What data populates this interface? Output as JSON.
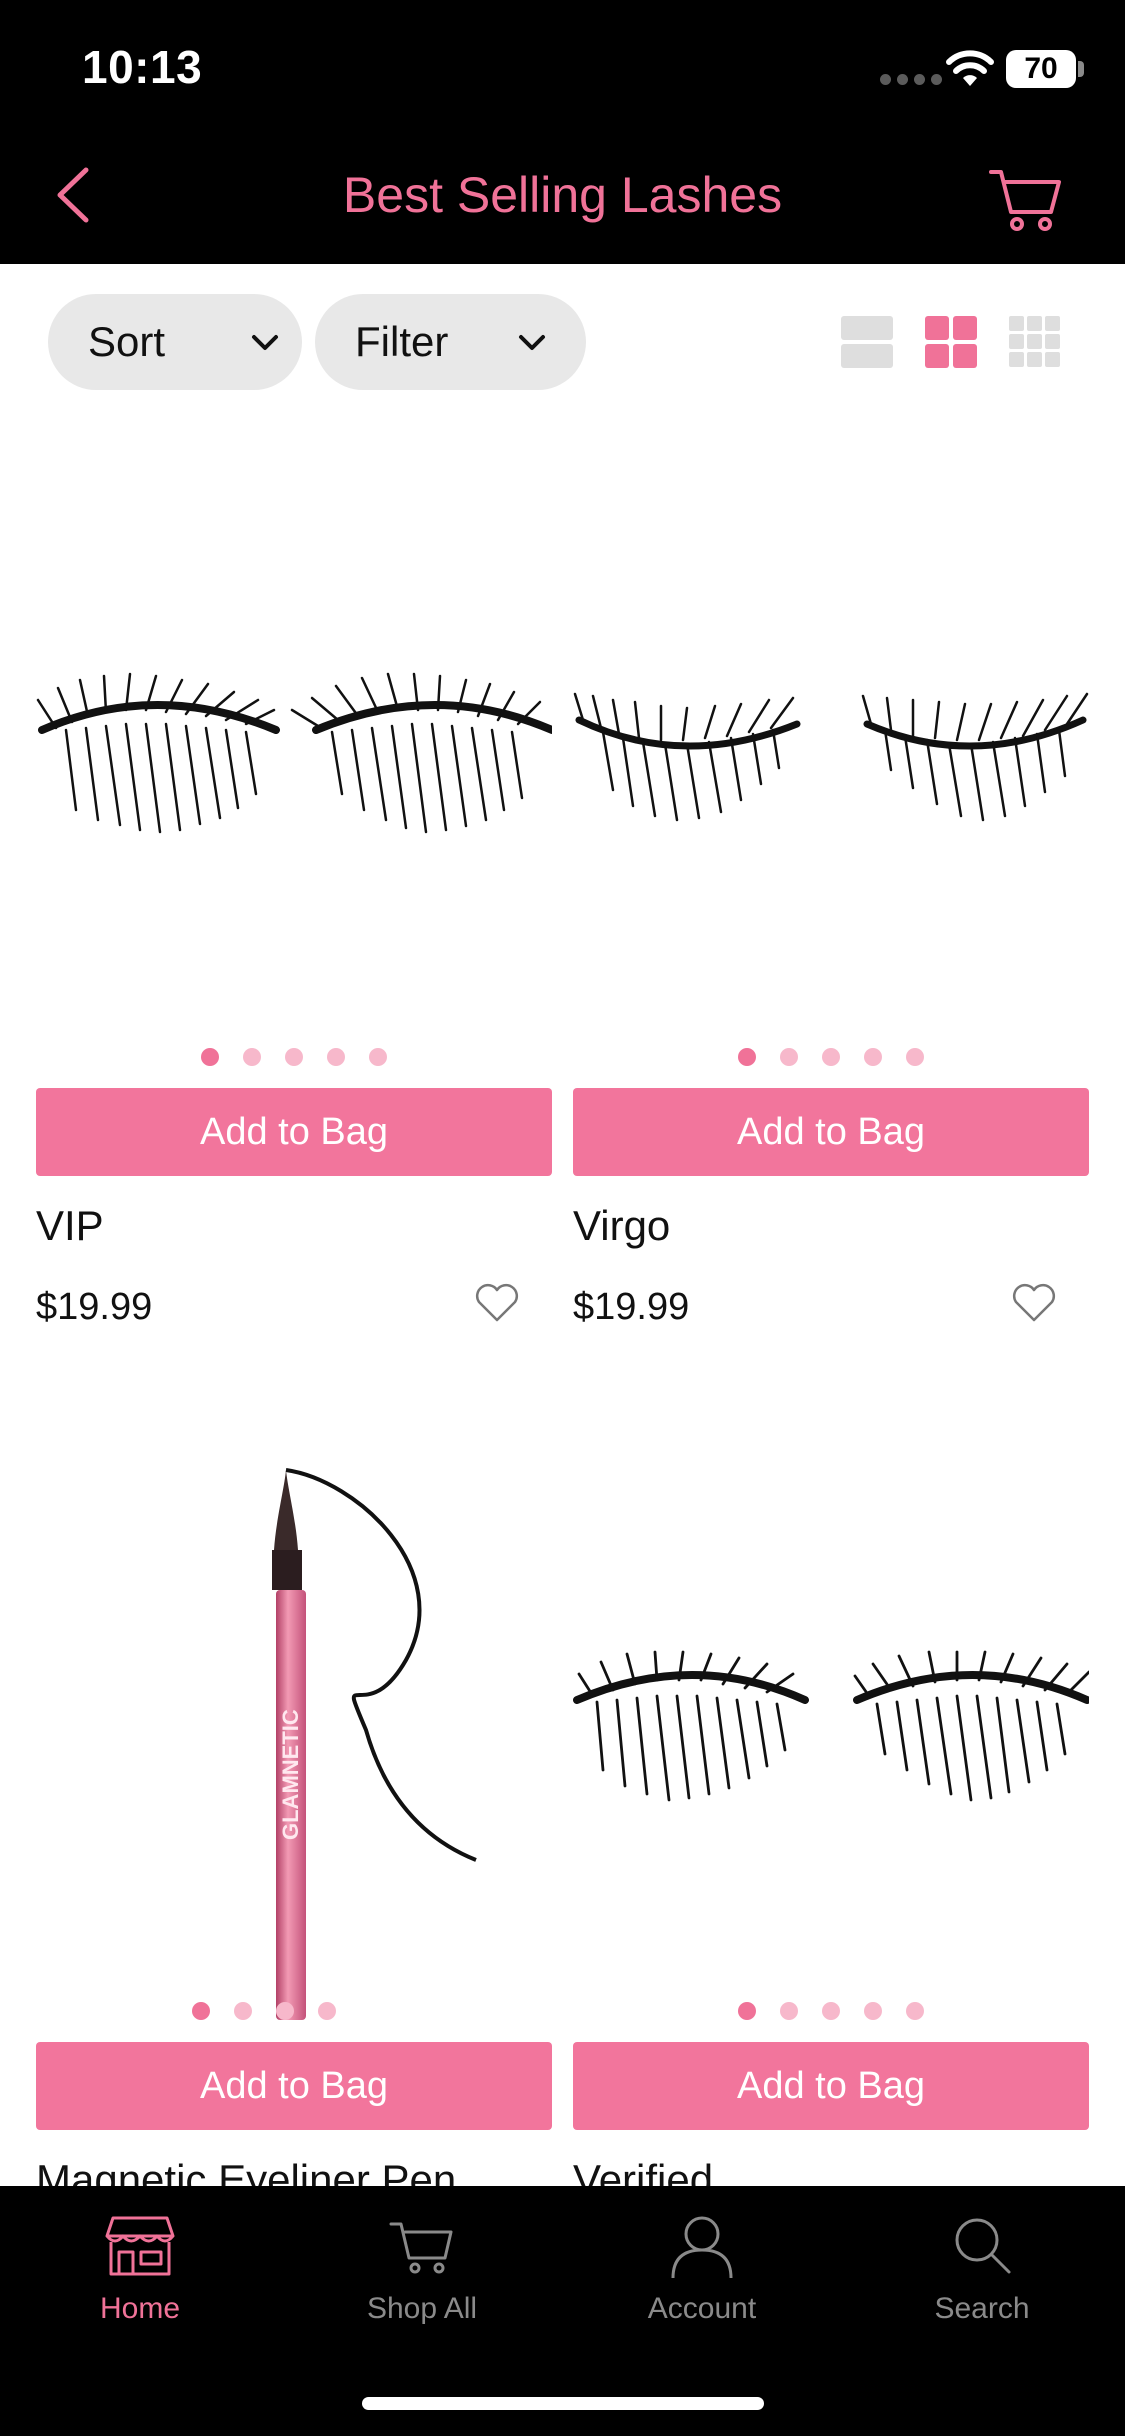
{
  "status_bar": {
    "time": "10:13",
    "battery": "70"
  },
  "header": {
    "title": "Best Selling Lashes",
    "back_icon": "chevron-left-icon",
    "cart_icon": "cart-icon"
  },
  "toolbar": {
    "sort_label": "Sort",
    "filter_label": "Filter",
    "view_modes": [
      "list-view-icon",
      "grid-2-view-icon",
      "grid-3-view-icon"
    ],
    "active_view": "grid-2-view-icon"
  },
  "products": [
    {
      "name": "VIP",
      "price": "$19.99",
      "button": "Add to Bag",
      "image_count": 5,
      "active_image": 1
    },
    {
      "name": "Virgo",
      "price": "$19.99",
      "button": "Add to Bag",
      "image_count": 5,
      "active_image": 1
    },
    {
      "name": "Magnetic Eyeliner Pen",
      "price": "",
      "button": "Add to Bag",
      "image_count": 4,
      "active_image": 1
    },
    {
      "name": "Verified",
      "price": "",
      "button": "Add to Bag",
      "image_count": 5,
      "active_image": 1
    }
  ],
  "tab_bar": {
    "items": [
      {
        "label": "Home",
        "icon": "store-icon",
        "active": true
      },
      {
        "label": "Shop All",
        "icon": "cart-icon",
        "active": false
      },
      {
        "label": "Account",
        "icon": "person-icon",
        "active": false
      },
      {
        "label": "Search",
        "icon": "search-icon",
        "active": false
      }
    ]
  },
  "colors": {
    "accent": "#f07298",
    "button": "#f2759c",
    "dot_inactive": "#f7b8cb",
    "bar_background": "#000000"
  }
}
